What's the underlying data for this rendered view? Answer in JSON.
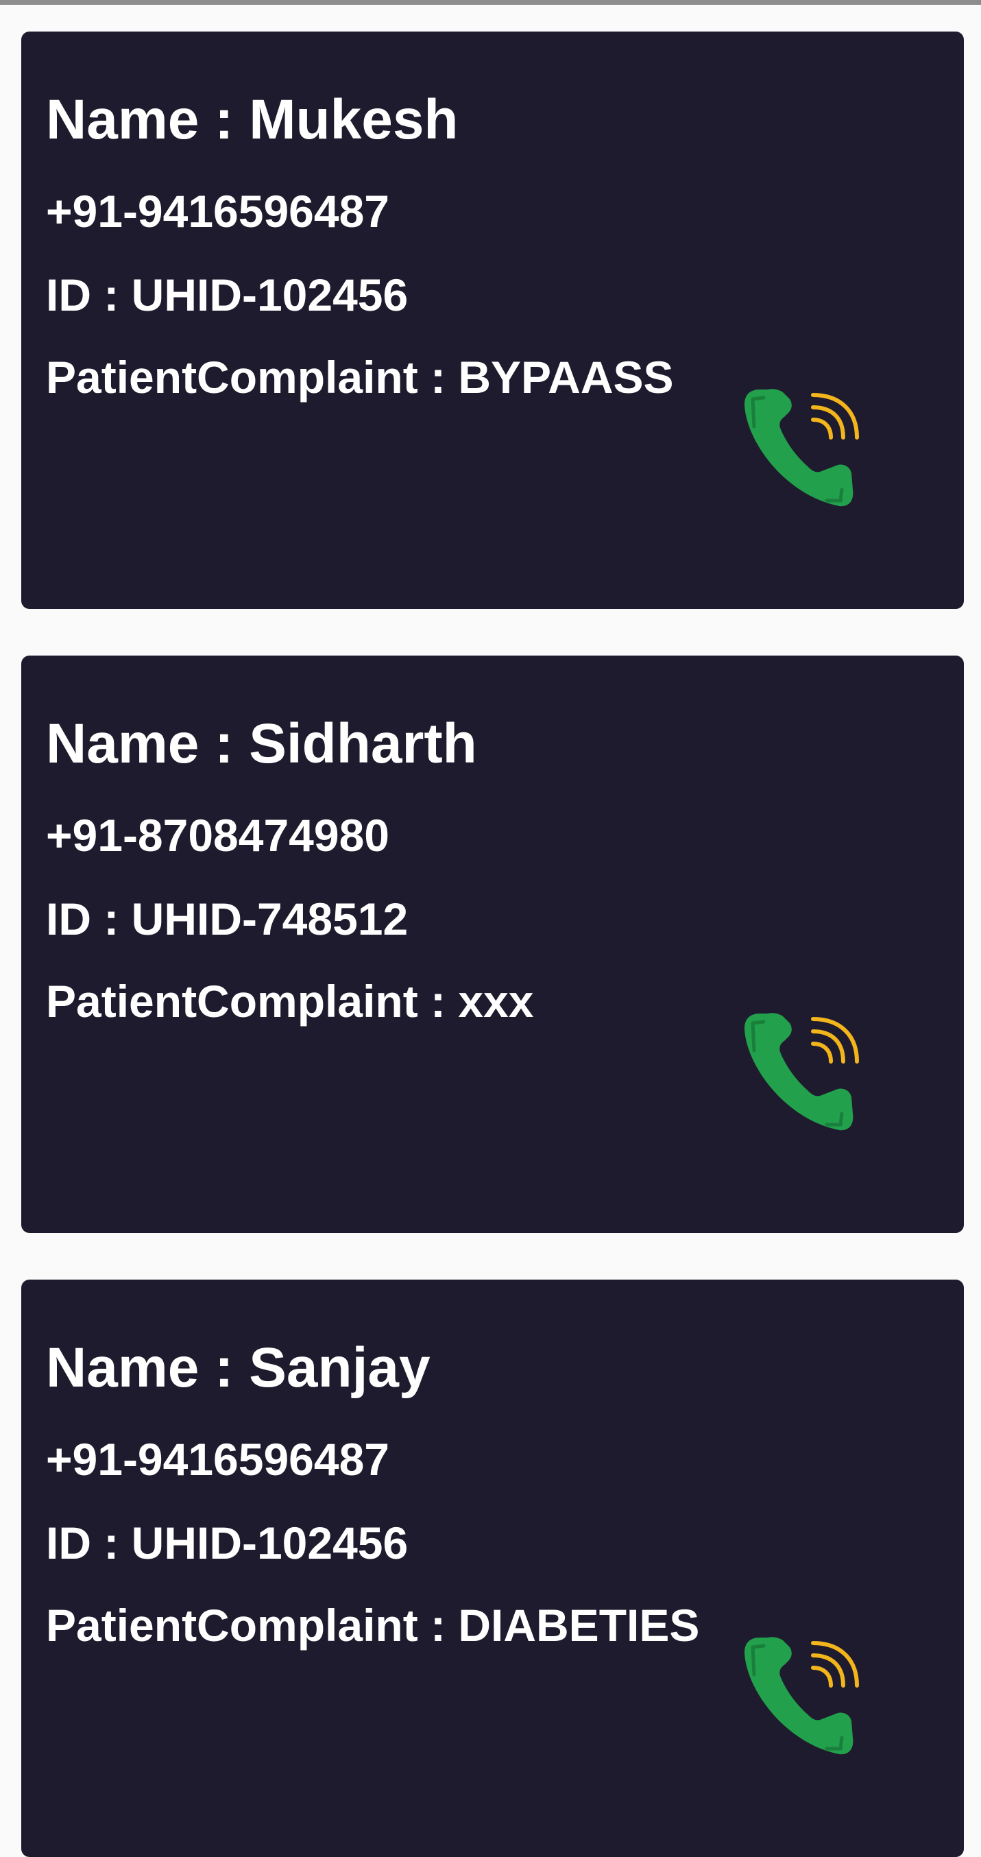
{
  "patients": [
    {
      "name": "Name : Mukesh",
      "phone": "+91-9416596487",
      "id": "ID : UHID-102456",
      "complaint": "PatientComplaint : BYPAASS"
    },
    {
      "name": "Name : Sidharth",
      "phone": "+91-8708474980",
      "id": "ID : UHID-748512",
      "complaint": "PatientComplaint : xxx"
    },
    {
      "name": "Name : Sanjay",
      "phone": "+91-9416596487",
      "id": "ID : UHID-102456",
      "complaint": "PatientComplaint : DIABETIES"
    }
  ],
  "icons": {
    "call": "phone-call-icon"
  },
  "colors": {
    "card_background": "#1f1b2e",
    "page_background": "#fafafa",
    "text": "#ffffff",
    "phone_icon": "#22a04b",
    "signal_waves": "#f2b51c"
  }
}
